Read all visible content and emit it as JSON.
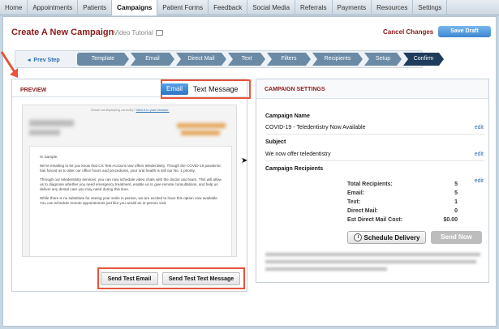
{
  "nav": {
    "tabs": [
      "Home",
      "Appointments",
      "Patients",
      "Campaigns",
      "Patient Forms",
      "Feedback",
      "Social Media",
      "Referrals",
      "Payments",
      "Resources",
      "Settings"
    ],
    "active": "Campaigns"
  },
  "header": {
    "title": "Create A New Campaign",
    "video_link": "Video Tutorial",
    "cancel": "Cancel Changes",
    "save_draft": "Save Draft"
  },
  "wizard": {
    "prev_step": "Prev Step",
    "steps": [
      "Template",
      "Email",
      "Direct Mail",
      "Text",
      "Filters",
      "Recipients",
      "Setup",
      "Confirm"
    ],
    "active": "Confirm"
  },
  "preview": {
    "label": "PREVIEW",
    "email_tab": "Email",
    "text_tab": "Text Message",
    "not_displaying": "Email not displaying correctly?",
    "view_in_browser": "View it in your browser.",
    "greeting": "Hi Sample,",
    "para1": "We're emailing to let you know that CS Test Account now offers teledentistry. Though the COVID-19 pandemic has forced us to alter our office hours and procedures, your oral health is still our No. 1 priority.",
    "para2": "Through our teledentistry services, you can now schedule video chats with the doctor and team. This will allow us to diagnose whether you need emergency treatment, enable us to give remote consultations, and help us deliver any dental care you may need during this time.",
    "para3": "While there is no substitute for seeing your smile in person, we are excited to have this option now available. You can schedule remote appointments just like you would an in-person visit.",
    "send_test_email": "Send Test Email",
    "send_test_text": "Send Test Text Message"
  },
  "settings": {
    "title": "CAMPAIGN SETTINGS",
    "campaign_name_label": "Campaign Name",
    "campaign_name": "COVID-19 - Teledentistry Now Available",
    "subject_label": "Subject",
    "subject": "We now offer teledentistry",
    "recipients_label": "Campaign Recipients",
    "edit": "edit",
    "recipients": [
      {
        "label": "Total Recipients:",
        "value": "5"
      },
      {
        "label": "Email:",
        "value": "5"
      },
      {
        "label": "Text:",
        "value": "1"
      },
      {
        "label": "Direct Mail:",
        "value": "0"
      },
      {
        "label": "Est Direct Mail Cost:",
        "value": "$0.00"
      }
    ],
    "schedule": "Schedule Delivery",
    "send_now": "Send Now"
  },
  "colors": {
    "accent_red": "#8b1a1a",
    "annotation": "#e8543c",
    "button_blue": "#3c86cf",
    "step_active": "#1e3c5c"
  }
}
